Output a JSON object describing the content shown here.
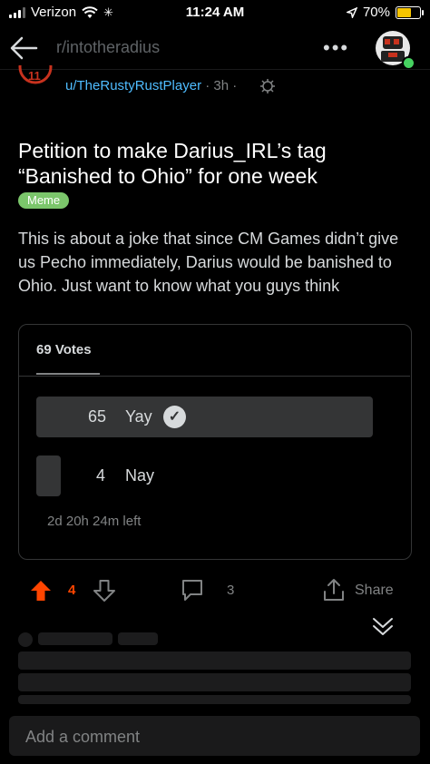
{
  "status_bar": {
    "carrier": "Verizon",
    "time": "11:24 AM",
    "battery": "70%",
    "battery_level": 0.7
  },
  "header": {
    "subreddit": "r/intotheradius",
    "more_icon": "more-icon",
    "back_icon": "back-arrow-icon"
  },
  "post": {
    "author": "u/TheRustyRustPlayer",
    "age": "· 3h ·",
    "title": "Petition to make Darius_IRL’s tag “Banished to Ohio” for one week",
    "flair": "Meme",
    "body": "This is about a joke that since CM Games didn’t give us Pecho immediately, Darius would be banished to Ohio. Just want to know what you guys think"
  },
  "poll": {
    "total_votes": "69 Votes",
    "options": [
      {
        "count": "65",
        "label": "Yay",
        "selected": true,
        "share": 0.942
      },
      {
        "count": "4",
        "label": "Nay",
        "selected": false,
        "share": 0.058
      }
    ],
    "time_left": "2d 20h 24m left"
  },
  "actions": {
    "upvotes": "4",
    "comments": "3",
    "share_label": "Share"
  },
  "comment_input": {
    "placeholder": "Add a comment"
  },
  "colors": {
    "background": "#000000",
    "upvote": "#ff4500",
    "link": "#4fbcff",
    "flair": "#7bc66b",
    "online": "#46d160"
  }
}
